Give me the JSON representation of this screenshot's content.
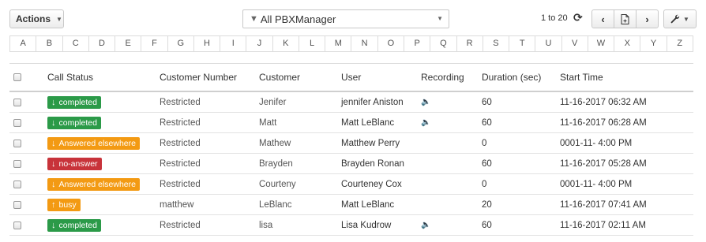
{
  "toolbar": {
    "actions_label": "Actions",
    "filter_value": "All PBXManager",
    "paging": "1 to 20"
  },
  "alphabet": [
    "A",
    "B",
    "C",
    "D",
    "E",
    "F",
    "G",
    "H",
    "I",
    "J",
    "K",
    "L",
    "M",
    "N",
    "O",
    "P",
    "Q",
    "R",
    "S",
    "T",
    "U",
    "V",
    "W",
    "X",
    "Y",
    "Z"
  ],
  "columns": {
    "status": "Call Status",
    "number": "Customer Number",
    "customer": "Customer",
    "user": "User",
    "recording": "Recording",
    "duration": "Duration (sec)",
    "start": "Start Time"
  },
  "status_colors": {
    "completed": "#2b9a48",
    "answered": "#f39a13",
    "no_answer": "#c8333a",
    "busy": "#f39a13"
  },
  "rows": [
    {
      "status": "completed",
      "status_color": "#2b9a48",
      "arrow": "down",
      "number": "Restricted",
      "customer": "Jenifer",
      "user": "jennifer Aniston",
      "recording": true,
      "duration": "60",
      "start": "11-16-2017 06:32 AM"
    },
    {
      "status": "completed",
      "status_color": "#2b9a48",
      "arrow": "down",
      "number": "Restricted",
      "customer": "Matt",
      "user": "Matt LeBlanc",
      "recording": true,
      "duration": "60",
      "start": "11-16-2017 06:28 AM"
    },
    {
      "status": "Answered elsewhere",
      "status_color": "#f39a13",
      "arrow": "down",
      "number": "Restricted",
      "customer": "Mathew",
      "user": "Matthew Perry",
      "recording": false,
      "duration": "0",
      "start": "0001-11- 4:00 PM"
    },
    {
      "status": "no-answer",
      "status_color": "#c8333a",
      "arrow": "down",
      "number": "Restricted",
      "customer": "Brayden",
      "user": "Brayden Ronan",
      "recording": false,
      "duration": "60",
      "start": "11-16-2017 05:28 AM"
    },
    {
      "status": "Answered elsewhere",
      "status_color": "#f39a13",
      "arrow": "down",
      "number": "Restricted",
      "customer": "Courteny",
      "user": "Courteney Cox",
      "recording": false,
      "duration": "0",
      "start": "0001-11- 4:00 PM"
    },
    {
      "status": "busy",
      "status_color": "#f39a13",
      "arrow": "up",
      "number": "matthew",
      "customer": "LeBlanc",
      "user": "Matt LeBlanc",
      "recording": false,
      "duration": "20",
      "start": "11-16-2017 07:41 AM"
    },
    {
      "status": "completed",
      "status_color": "#2b9a48",
      "arrow": "down",
      "number": "Restricted",
      "customer": "lisa",
      "user": "Lisa Kudrow",
      "recording": true,
      "duration": "60",
      "start": "11-16-2017 02:11 AM"
    }
  ]
}
